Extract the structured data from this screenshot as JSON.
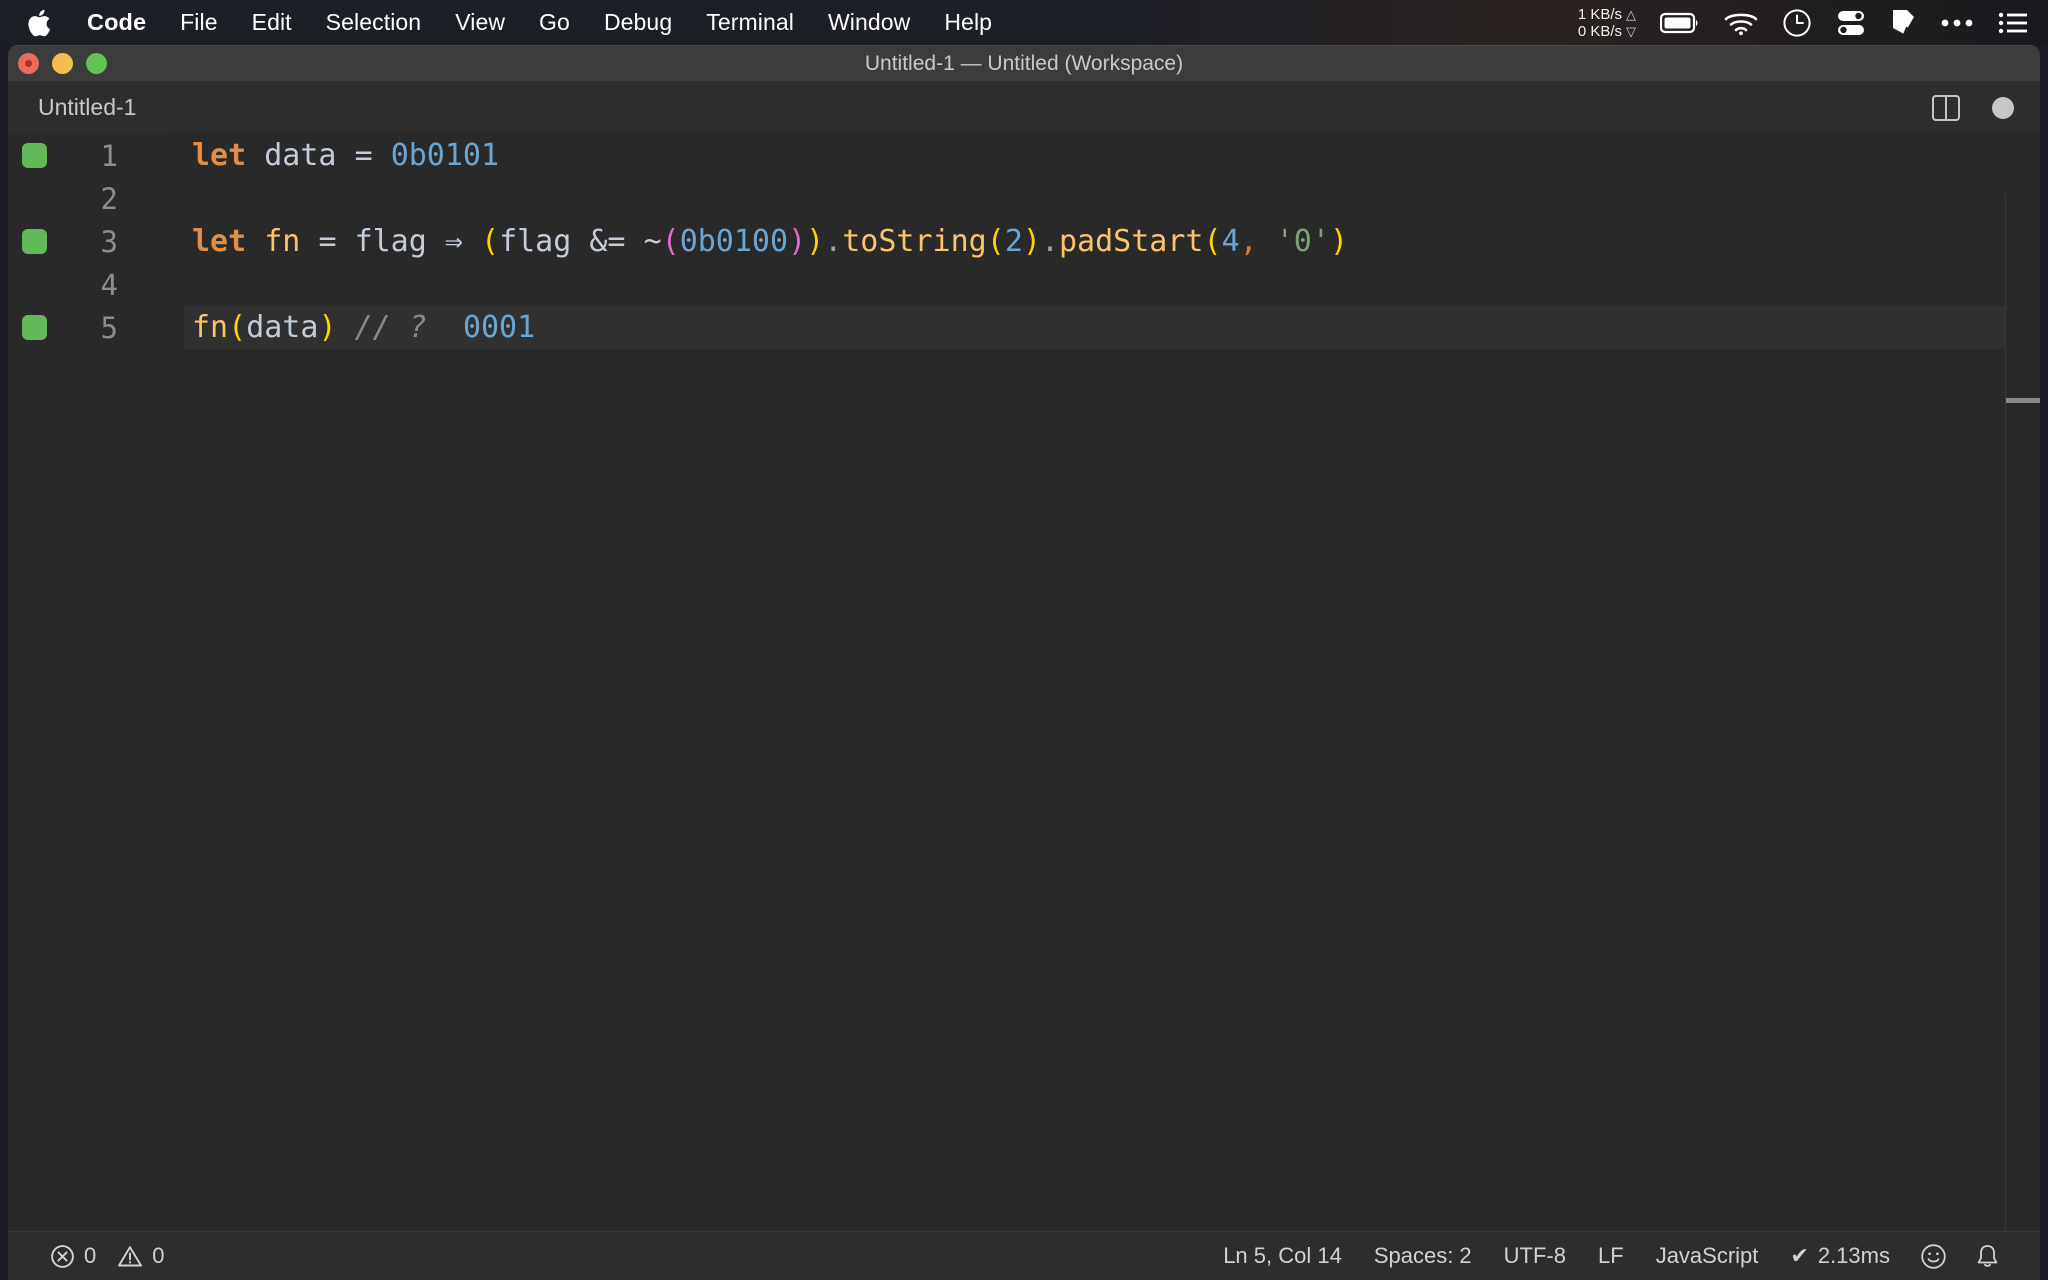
{
  "menubar": {
    "apple_icon": "apple-logo-icon",
    "items": [
      {
        "label": "Code",
        "bold": true
      },
      {
        "label": "File",
        "bold": false
      },
      {
        "label": "Edit",
        "bold": false
      },
      {
        "label": "Selection",
        "bold": false
      },
      {
        "label": "View",
        "bold": false
      },
      {
        "label": "Go",
        "bold": false
      },
      {
        "label": "Debug",
        "bold": false
      },
      {
        "label": "Terminal",
        "bold": false
      },
      {
        "label": "Window",
        "bold": false
      },
      {
        "label": "Help",
        "bold": false
      }
    ],
    "network": {
      "up": "1 KB/s",
      "down": "0 KB/s",
      "up_arrow": "△",
      "down_arrow": "▽"
    },
    "status_icons": [
      "battery-icon",
      "wifi-icon",
      "clock-icon",
      "toggles-icon",
      "pen-nib-icon",
      "ellipsis-icon",
      "list-icon"
    ]
  },
  "window": {
    "title": "Untitled-1 — Untitled (Workspace)",
    "traffic_lights": [
      "close-button",
      "minimize-button",
      "maximize-button"
    ]
  },
  "tabbar": {
    "tabs": [
      {
        "label": "Untitled-1",
        "active": true
      }
    ],
    "actions": [
      "split-editor-icon",
      "unsaved-indicator-dot"
    ]
  },
  "editor": {
    "lines": [
      {
        "number": "1",
        "marker": true,
        "current": false,
        "tokens": [
          {
            "text": "let",
            "cls": "t-kw"
          },
          {
            "text": " ",
            "cls": "t-op"
          },
          {
            "text": "data",
            "cls": "t-var"
          },
          {
            "text": " ",
            "cls": "t-op"
          },
          {
            "text": "=",
            "cls": "t-op"
          },
          {
            "text": " ",
            "cls": "t-op"
          },
          {
            "text": "0b0101",
            "cls": "t-num"
          }
        ]
      },
      {
        "number": "2",
        "marker": false,
        "current": false,
        "tokens": []
      },
      {
        "number": "3",
        "marker": true,
        "current": false,
        "tokens": [
          {
            "text": "let",
            "cls": "t-kw"
          },
          {
            "text": " ",
            "cls": "t-op"
          },
          {
            "text": "fn",
            "cls": "t-fn"
          },
          {
            "text": " ",
            "cls": "t-op"
          },
          {
            "text": "=",
            "cls": "t-op"
          },
          {
            "text": " ",
            "cls": "t-op"
          },
          {
            "text": "flag",
            "cls": "t-var"
          },
          {
            "text": " ",
            "cls": "t-op"
          },
          {
            "text": "⇒",
            "cls": "t-var"
          },
          {
            "text": " ",
            "cls": "t-op"
          },
          {
            "text": "(",
            "cls": "t-b1"
          },
          {
            "text": "flag",
            "cls": "t-var"
          },
          {
            "text": " ",
            "cls": "t-op"
          },
          {
            "text": "&=",
            "cls": "t-op"
          },
          {
            "text": " ",
            "cls": "t-op"
          },
          {
            "text": "~",
            "cls": "t-op"
          },
          {
            "text": "(",
            "cls": "t-b2"
          },
          {
            "text": "0b0100",
            "cls": "t-num"
          },
          {
            "text": ")",
            "cls": "t-b2"
          },
          {
            "text": ")",
            "cls": "t-b1"
          },
          {
            "text": ".",
            "cls": "t-dot"
          },
          {
            "text": "toString",
            "cls": "t-fn"
          },
          {
            "text": "(",
            "cls": "t-b1"
          },
          {
            "text": "2",
            "cls": "t-num"
          },
          {
            "text": ")",
            "cls": "t-b1"
          },
          {
            "text": ".",
            "cls": "t-dot"
          },
          {
            "text": "padStart",
            "cls": "t-fn"
          },
          {
            "text": "(",
            "cls": "t-b1"
          },
          {
            "text": "4",
            "cls": "t-num"
          },
          {
            "text": ",",
            "cls": "t-comma"
          },
          {
            "text": " ",
            "cls": "t-op"
          },
          {
            "text": "'0'",
            "cls": "t-str"
          },
          {
            "text": ")",
            "cls": "t-b1"
          }
        ]
      },
      {
        "number": "4",
        "marker": false,
        "current": false,
        "tokens": []
      },
      {
        "number": "5",
        "marker": true,
        "current": true,
        "tokens": [
          {
            "text": "fn",
            "cls": "t-fn"
          },
          {
            "text": "(",
            "cls": "t-b1"
          },
          {
            "text": "data",
            "cls": "t-var"
          },
          {
            "text": ")",
            "cls": "t-b1"
          },
          {
            "text": " ",
            "cls": "t-op"
          },
          {
            "text": "// ?",
            "cls": "t-cmt"
          },
          {
            "text": "  ",
            "cls": "t-op"
          },
          {
            "text": "0001",
            "cls": "t-num"
          }
        ]
      }
    ]
  },
  "statusbar": {
    "errors": "0",
    "warnings": "0",
    "cursor": "Ln 5, Col 14",
    "indentation": "Spaces: 2",
    "encoding": "UTF-8",
    "eol": "LF",
    "language": "JavaScript",
    "run_status": "2.13ms",
    "run_check": "✔",
    "icons": [
      "error-icon",
      "warning-icon",
      "smiley-icon",
      "bell-icon"
    ]
  },
  "colors": {
    "menubar_bg": "#1d1f27",
    "titlebar_bg": "#3c3c3c",
    "tabbar_bg": "#2d2d2d",
    "editor_bg": "#292929",
    "statusbar_bg": "#2d2d2d",
    "marker_green": "#63b95a",
    "keyword_orange": "#e08e45",
    "number_blue": "#6aa6d4",
    "function_gold": "#fcc46a",
    "string_green": "#7aa472",
    "bracket_yellow": "#ffd400",
    "bracket_magenta": "#e06ec7"
  }
}
